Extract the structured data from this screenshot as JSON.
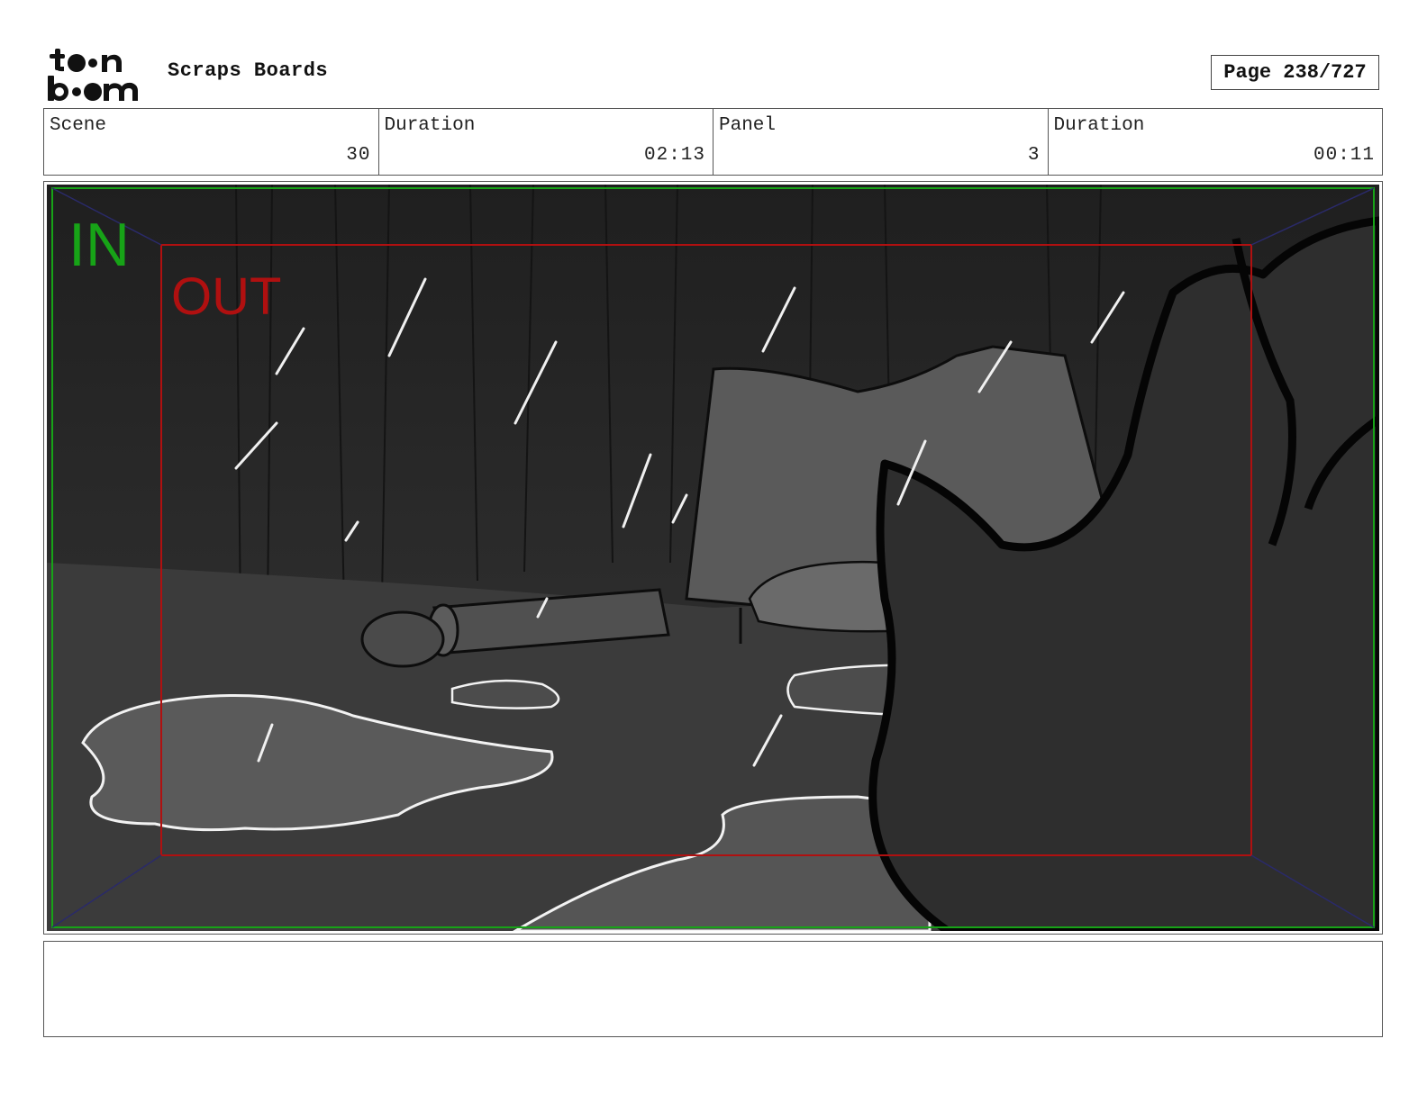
{
  "header": {
    "logo_text": "toonboom",
    "project_title": "Scraps Boards",
    "page_label": "Page 238/727"
  },
  "info": {
    "scene_label": "Scene",
    "scene_value": "30",
    "scene_duration_label": "Duration",
    "scene_duration_value": "02:13",
    "panel_label": "Panel",
    "panel_value": "3",
    "panel_duration_label": "Duration",
    "panel_duration_value": "00:11"
  },
  "panel": {
    "in_label": "IN",
    "out_label": "OUT",
    "in_color": "#17a317",
    "out_color": "#b01010"
  },
  "notes": {
    "text": ""
  }
}
